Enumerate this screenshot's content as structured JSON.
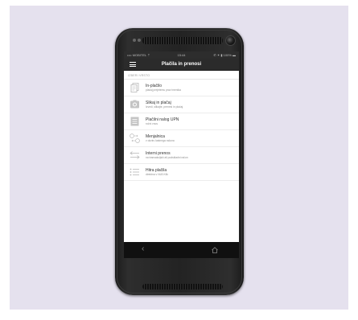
{
  "status": {
    "carrier": "•••• MOBITEL ⇡",
    "time": "15:44",
    "right": "✆ ✶ ▮ 100% ▬"
  },
  "header": {
    "title": "Plačila in prenosi"
  },
  "section": {
    "title": "IZBERI VRSTO"
  },
  "items": [
    {
      "title": "In-plačilo",
      "subtitle": "plačaj prejetemu prav imenika",
      "icon": "document-icon"
    },
    {
      "title": "Slikaj in plačaj",
      "subtitle": "Izvedi, slikajte, prenesi in plačaj",
      "icon": "camera-icon"
    },
    {
      "title": "Plačilni nalog UPN",
      "subtitle": "ročni vnos",
      "icon": "form-icon"
    },
    {
      "title": "Menjalnica",
      "subtitle": "v okviru lastnega računa",
      "icon": "currency-exchange-icon"
    },
    {
      "title": "Interni prenos",
      "subtitle": "na transakcijski ali podskladni račun",
      "icon": "transfer-arrows-icon"
    },
    {
      "title": "Hitra plačila",
      "subtitle": "direktna v NLB Klik",
      "icon": "list-icon"
    }
  ],
  "nav": {
    "back": "‹"
  },
  "colors": {
    "backdrop": "#e5e1ee",
    "appbar": "#2b2b2b",
    "icon": "#b8b8b8"
  }
}
